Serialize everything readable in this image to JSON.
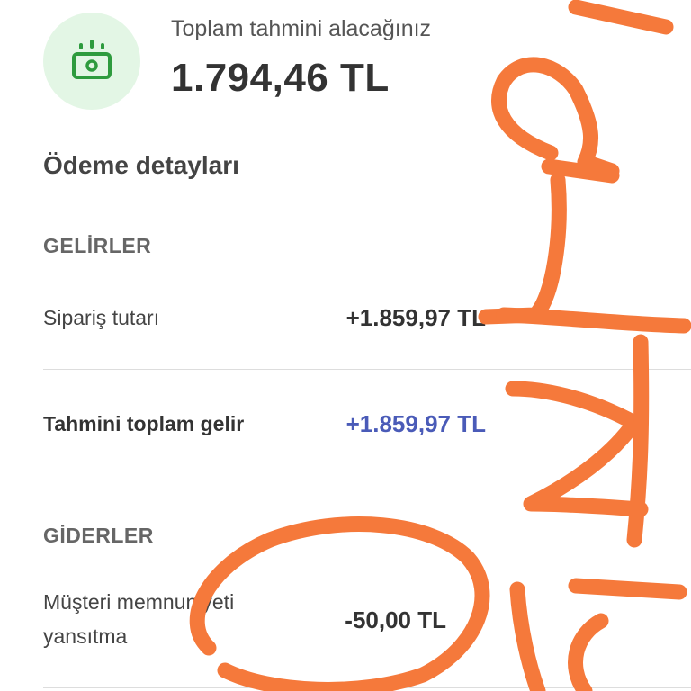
{
  "summary": {
    "icon": "cash-icon",
    "label": "Toplam tahmini alacağınız",
    "amount": "1.794,46 TL"
  },
  "details": {
    "title": "Ödeme detayları",
    "income": {
      "header": "GELİRLER",
      "order_label": "Sipariş tutarı",
      "order_value": "+1.859,97 TL",
      "total_label": "Tahmini toplam gelir",
      "total_value": "+1.859,97 TL"
    },
    "expenses": {
      "header": "GİDERLER",
      "satisfaction_label_line1": "Müşteri memnuniyeti",
      "satisfaction_label_line2": "yansıtma",
      "satisfaction_value": "-50,00 TL"
    }
  },
  "colors": {
    "icon_bg": "#e3f6e5",
    "icon_green": "#2e9b3e",
    "accent_blue": "#4a5bb8",
    "scribble_orange": "#f5793b"
  }
}
